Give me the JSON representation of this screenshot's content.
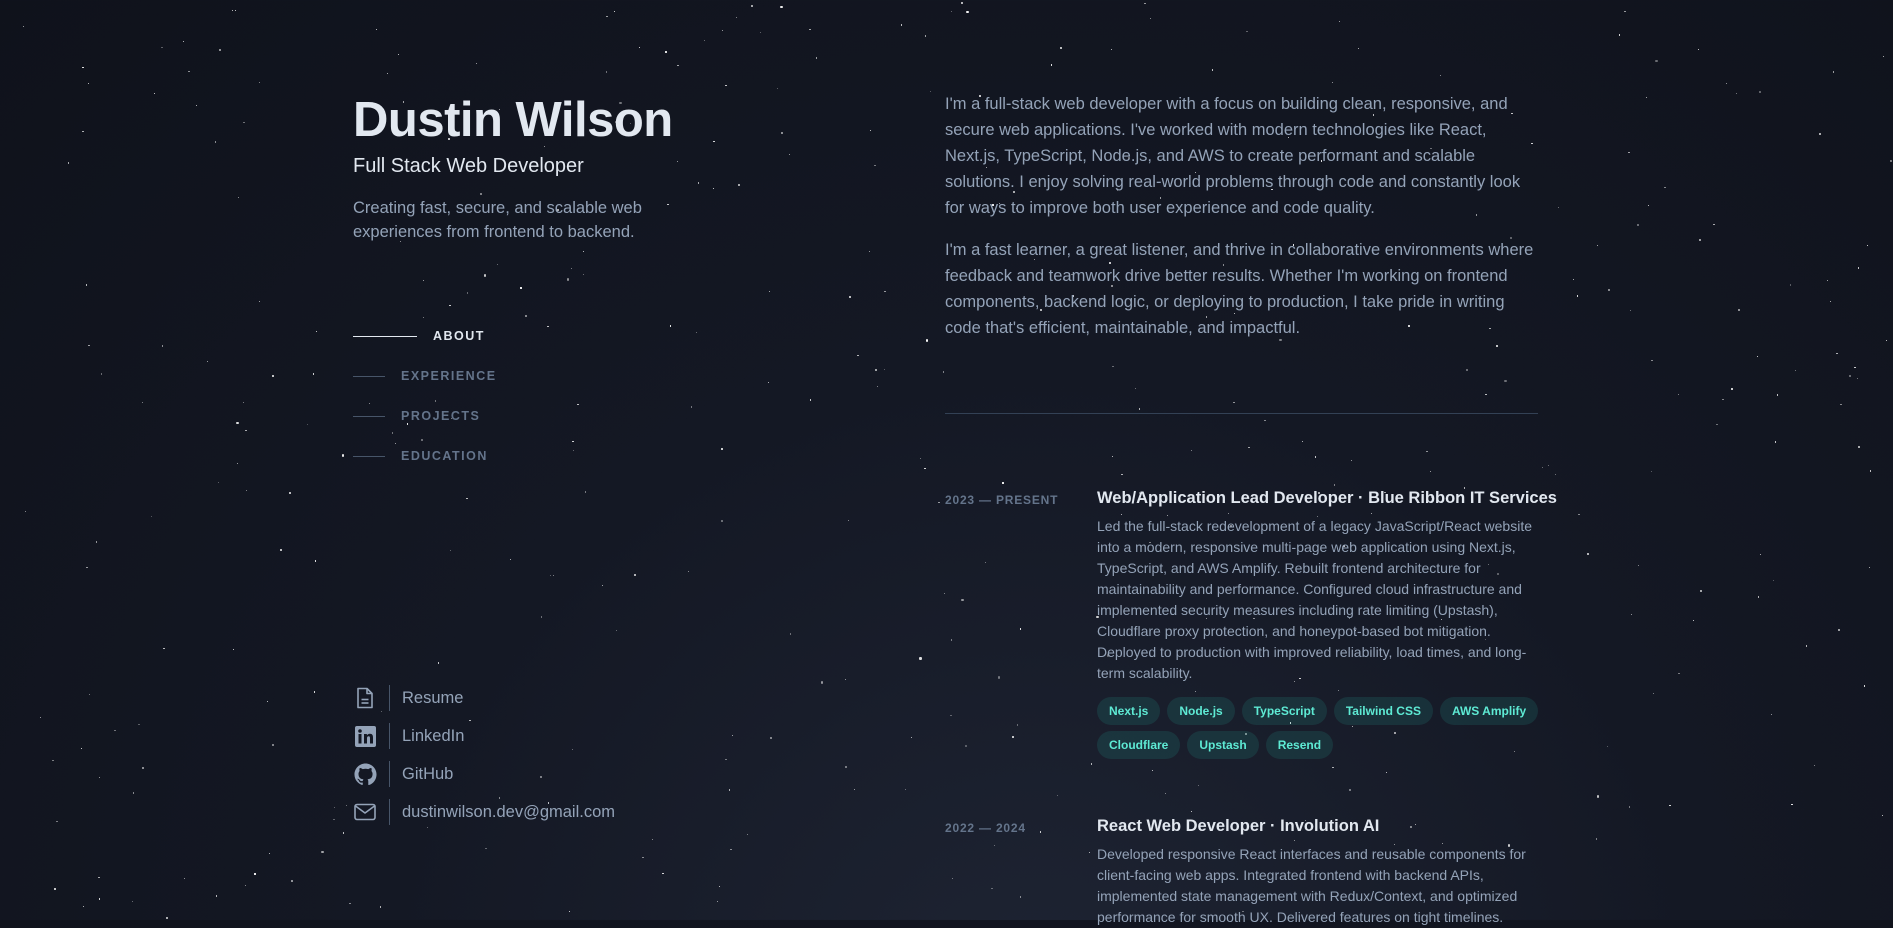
{
  "profile": {
    "name": "Dustin Wilson",
    "title": "Full Stack Web Developer",
    "tagline": "Creating fast, secure, and scalable web experiences from frontend to backend."
  },
  "nav": [
    {
      "label": "ABOUT",
      "active": true
    },
    {
      "label": "EXPERIENCE",
      "active": false
    },
    {
      "label": "PROJECTS",
      "active": false
    },
    {
      "label": "EDUCATION",
      "active": false
    }
  ],
  "links": [
    {
      "icon": "document-icon",
      "label": "Resume"
    },
    {
      "icon": "linkedin-icon",
      "label": "LinkedIn"
    },
    {
      "icon": "github-icon",
      "label": "GitHub"
    },
    {
      "icon": "mail-icon",
      "label": "dustinwilson.dev@gmail.com"
    }
  ],
  "about": {
    "p1": "I'm a full-stack web developer with a focus on building clean, responsive, and secure web applications. I've worked with modern technologies like React, Next.js, TypeScript, Node.js, and AWS to create performant and scalable solutions. I enjoy solving real-world problems through code and constantly look for ways to improve both user experience and code quality.",
    "p2": "I'm a fast learner, a great listener, and thrive in collaborative environments where feedback and teamwork drive better results. Whether I'm working on frontend components, backend logic, or deploying to production, I take pride in writing code that's efficient, maintainable, and impactful."
  },
  "experience": [
    {
      "date": "2023 — PRESENT",
      "title": "Web/Application Lead Developer · Blue Ribbon IT Services",
      "description": "Led the full-stack redevelopment of a legacy JavaScript/React website into a modern, responsive multi-page web application using Next.js, TypeScript, and AWS Amplify. Rebuilt frontend architecture for maintainability and performance. Configured cloud infrastructure and implemented security measures including rate limiting (Upstash), Cloudflare proxy protection, and honeypot-based bot mitigation. Deployed to production with improved reliability, load times, and long-term scalability.",
      "tags": [
        "Next.js",
        "Node.js",
        "TypeScript",
        "Tailwind CSS",
        "AWS Amplify",
        "Cloudflare",
        "Upstash",
        "Resend"
      ]
    },
    {
      "date": "2022 — 2024",
      "title": "React Web Developer · Involution AI",
      "description": "Developed responsive React interfaces and reusable components for client-facing web apps. Integrated frontend with backend APIs, implemented state management with Redux/Context, and optimized performance for smooth UX. Delivered features on tight timelines.",
      "tags": []
    }
  ],
  "colors": {
    "background": "#0f121b",
    "heading": "#e2e8f0",
    "body_text": "#94a3b8",
    "muted": "#64748b",
    "tag_text": "#5eead4",
    "tag_bg": "rgba(45,212,191,0.12)"
  }
}
